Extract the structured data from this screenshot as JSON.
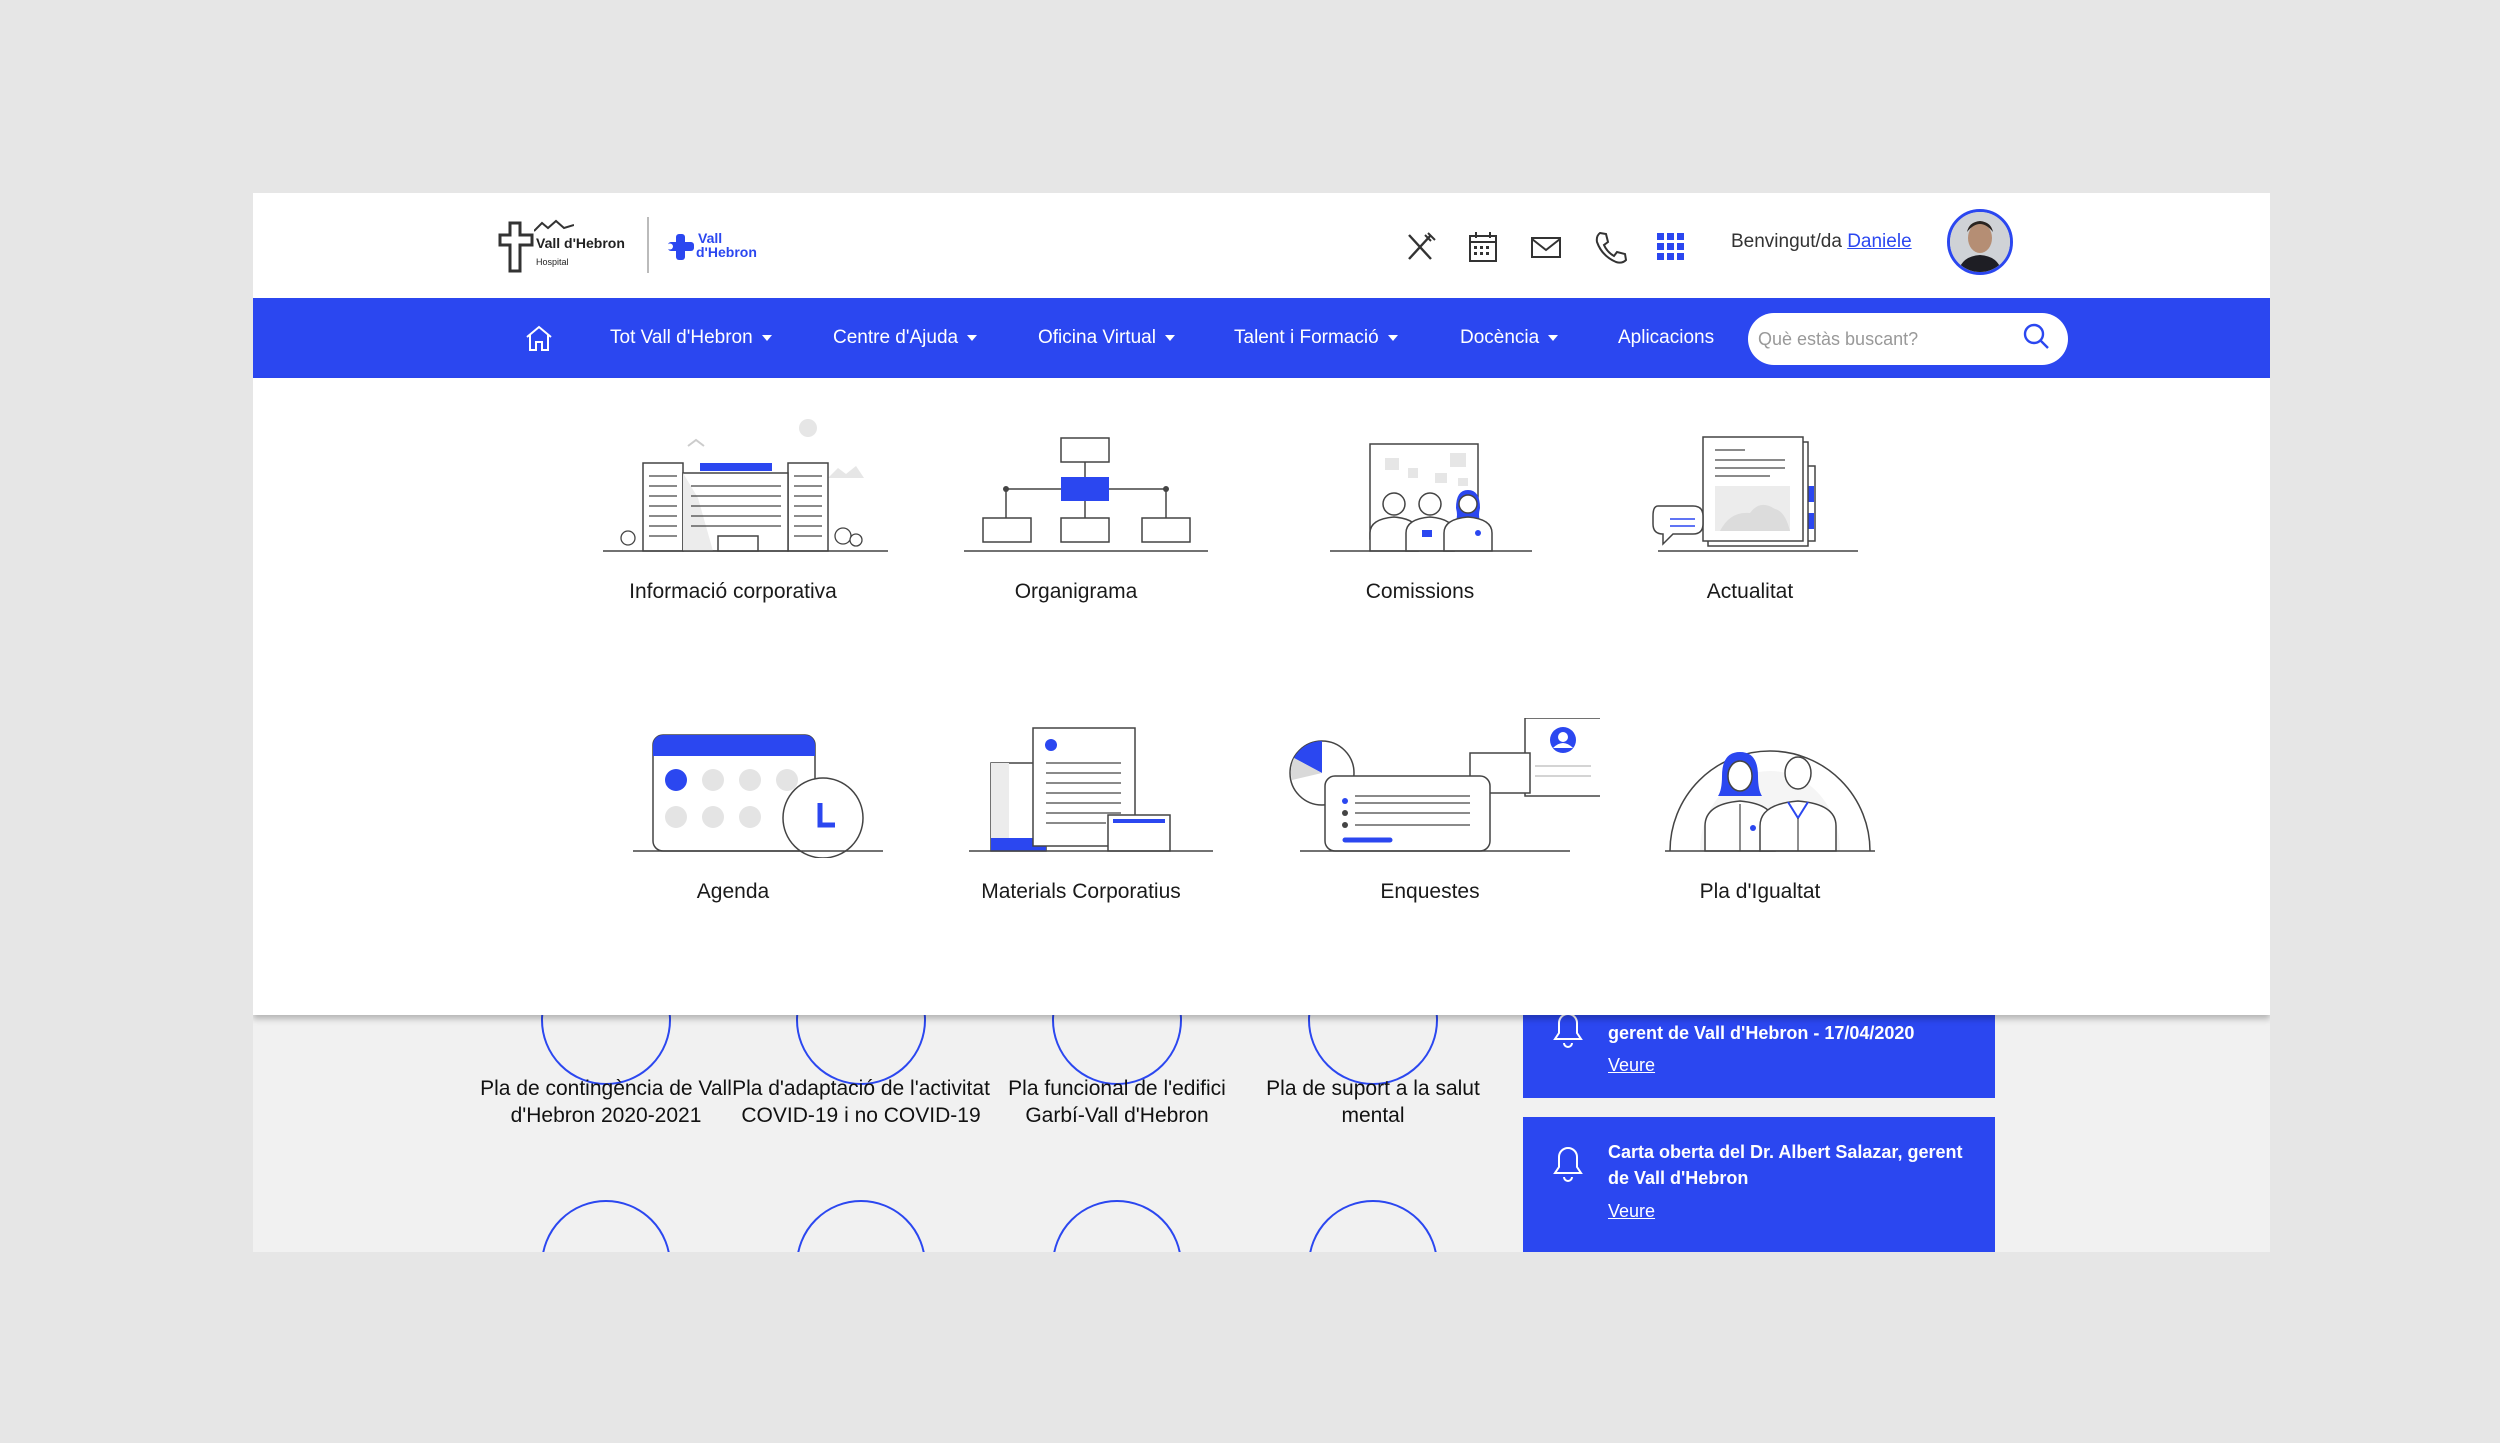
{
  "header": {
    "hospital_logo": "Vall d'Hebron",
    "hospital_logo_sub": "Hospital",
    "vh_logo_line1": "Vall",
    "vh_logo_line2": "d'Hebron",
    "tools": [
      "cutlery-icon",
      "calendar-icon",
      "mail-icon",
      "phone-icon",
      "apps-grid-icon"
    ],
    "welcome_text": "Benvingut/da",
    "user_name": "Daniele"
  },
  "nav": {
    "items": [
      {
        "label": "Tot Vall d'Hebron",
        "dropdown": true
      },
      {
        "label": "Centre d'Ajuda",
        "dropdown": true
      },
      {
        "label": "Oficina Virtual",
        "dropdown": true
      },
      {
        "label": "Talent i Formació",
        "dropdown": true
      },
      {
        "label": "Docència",
        "dropdown": true
      },
      {
        "label": "Aplicacions",
        "dropdown": false
      }
    ],
    "search_placeholder": "Què estàs buscant?"
  },
  "menu": {
    "tiles": [
      {
        "label": "Informació corporativa",
        "icon": "building-illustration-icon"
      },
      {
        "label": "Organigrama",
        "icon": "org-chart-illustration-icon"
      },
      {
        "label": "Comissions",
        "icon": "committee-illustration-icon"
      },
      {
        "label": "Actualitat",
        "icon": "news-illustration-icon"
      },
      {
        "label": "Agenda",
        "icon": "agenda-illustration-icon"
      },
      {
        "label": "Materials Corporatius",
        "icon": "documents-illustration-icon"
      },
      {
        "label": "Enquestes",
        "icon": "survey-illustration-icon"
      },
      {
        "label": "Pla d'Igualtat",
        "icon": "equality-illustration-icon"
      }
    ]
  },
  "background": {
    "plans": [
      "Pla de contingència de Vall d'Hebron 2020-2021",
      "Pla d'adaptació de l'activitat COVID-19 i no COVID-19",
      "Pla funcional de l'edifici Garbí-Vall d'Hebron",
      "Pla de suport a la salut mental"
    ],
    "notices": [
      {
        "title": "gerent de Vall d'Hebron - 17/04/2020",
        "link": "Veure"
      },
      {
        "title": "Carta oberta del Dr. Albert Salazar, gerent de Vall d'Hebron",
        "link": "Veure"
      }
    ]
  },
  "colors": {
    "accent": "#2b47f0",
    "page_bg": "#e6e6e6"
  }
}
